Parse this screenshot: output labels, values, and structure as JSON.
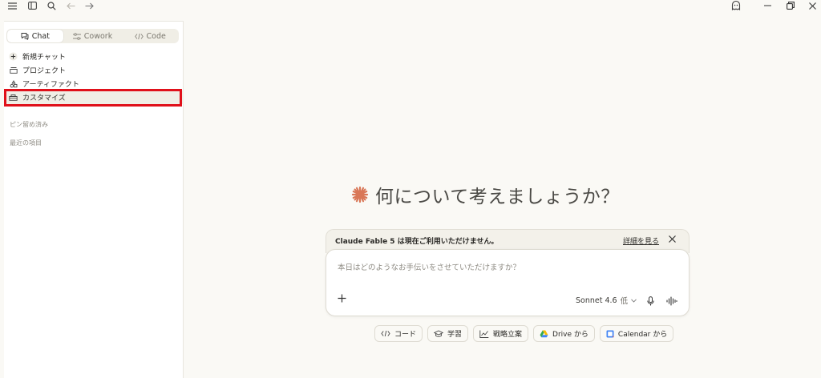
{
  "sidebar": {
    "modes": [
      {
        "label": "Chat",
        "active": true
      },
      {
        "label": "Cowork",
        "active": false
      },
      {
        "label": "Code",
        "active": false
      }
    ],
    "nav": [
      {
        "label": "新規チャット",
        "icon": "plus-circle-icon"
      },
      {
        "label": "プロジェクト",
        "icon": "folder-icon"
      },
      {
        "label": "アーティファクト",
        "icon": "artifact-icon"
      },
      {
        "label": "カスタマイズ",
        "icon": "customize-icon"
      }
    ],
    "pinned_label": "ピン留め済み",
    "recent_label": "最近の項目"
  },
  "main": {
    "greeting": "何について考えましょうか？",
    "notice": {
      "text": "Claude Fable 5 は現在ご利用いただけません。",
      "link": "詳細を見る"
    },
    "composer": {
      "placeholder": "本日はどのようなお手伝いをさせていただけますか？",
      "model": "Sonnet 4.6",
      "level": "低"
    },
    "chips": [
      {
        "label": "コード",
        "icon": "code-icon"
      },
      {
        "label": "学習",
        "icon": "graduation-cap-icon"
      },
      {
        "label": "戦略立案",
        "icon": "chart-line-icon"
      },
      {
        "label": "Drive から",
        "icon": "google-drive-icon"
      },
      {
        "label": "Calendar から",
        "icon": "google-calendar-icon"
      }
    ]
  },
  "colors": {
    "accent": "#d97757",
    "highlight": "#e0101a",
    "background": "#faf9f5"
  }
}
